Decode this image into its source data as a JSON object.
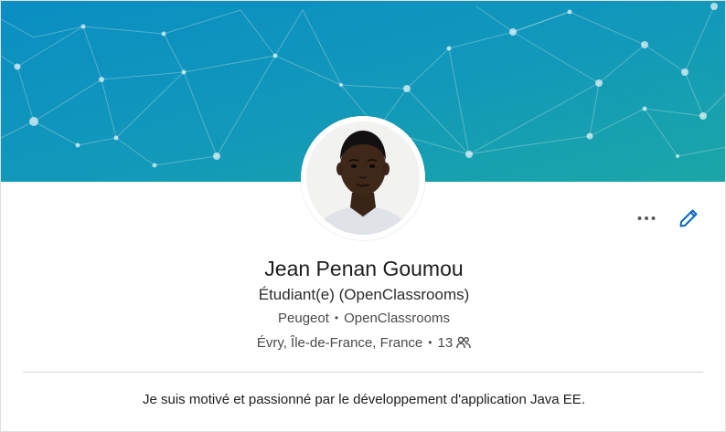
{
  "profile": {
    "name": "Jean Penan Goumou",
    "headline": "Étudiant(e) (OpenClassrooms)",
    "companies": [
      "Peugeot",
      "OpenClassrooms"
    ],
    "location": "Évry, Île-de-France, France",
    "connections": "13",
    "summary": "Je suis motivé et passionné par le développement d'application Java EE."
  },
  "icons": {
    "more": "more-horizontal-icon",
    "edit": "pencil-icon",
    "connections": "people-icon"
  },
  "colors": {
    "banner_start": "#0a8fc2",
    "banner_end": "#1aa6a6",
    "accent": "#0a66c2"
  }
}
